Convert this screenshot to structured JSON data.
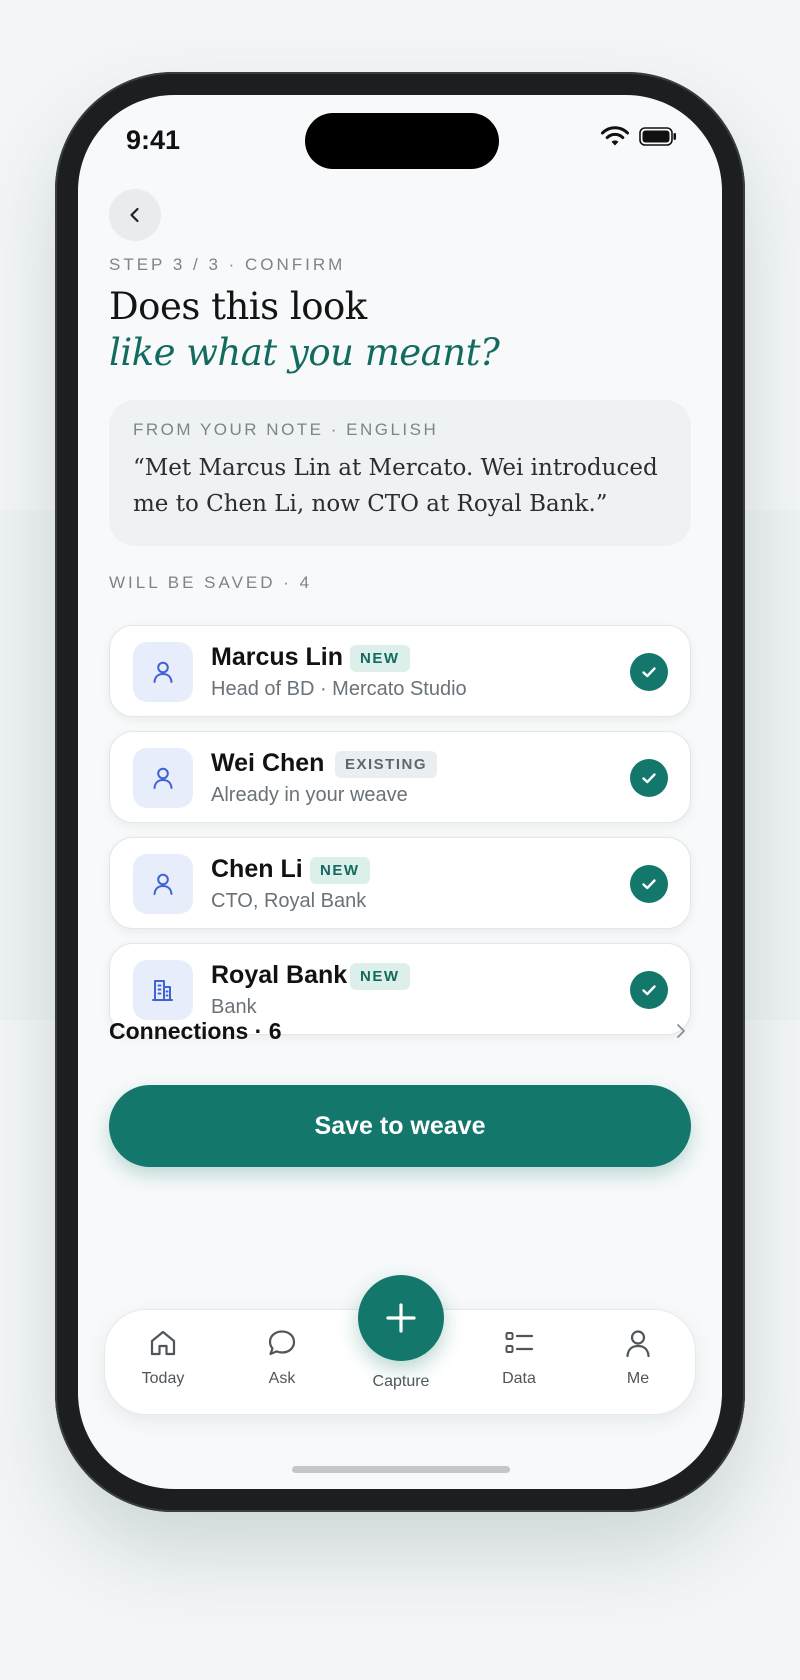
{
  "status_bar": {
    "time": "9:41"
  },
  "header": {
    "step": "STEP 3 / 3 · CONFIRM",
    "title_line1": "Does this look",
    "title_line2": "like what you meant?"
  },
  "note": {
    "label": "FROM YOUR NOTE · ENGLISH",
    "quote": "“Met Marcus Lin at Mercato. Wei introduced me to Chen Li, now CTO at Royal Bank.”"
  },
  "saved": {
    "label": "WILL BE SAVED · 4",
    "items": [
      {
        "name": "Marcus Lin",
        "badge": "NEW",
        "subtitle": "Head of BD · Mercato Studio",
        "icon": "person-icon",
        "checked": true
      },
      {
        "name": "Wei Chen",
        "badge": "EXISTING",
        "subtitle": "Already in your weave",
        "icon": "person-icon",
        "checked": true
      },
      {
        "name": "Chen Li",
        "badge": "NEW",
        "subtitle": "CTO, Royal Bank",
        "icon": "person-icon",
        "checked": true
      },
      {
        "name": "Royal Bank",
        "badge": "NEW",
        "subtitle": "Bank",
        "icon": "building-icon",
        "checked": true
      }
    ]
  },
  "connections": {
    "label": "Connections · 6"
  },
  "actions": {
    "save_label": "Save to weave"
  },
  "tab_bar": {
    "tabs": [
      {
        "label": "Today",
        "icon": "home-icon"
      },
      {
        "label": "Ask",
        "icon": "chat-bubble-icon"
      },
      {
        "label": "Capture",
        "icon": "plus-icon"
      },
      {
        "label": "Data",
        "icon": "list-icon"
      },
      {
        "label": "Me",
        "icon": "profile-icon"
      }
    ]
  },
  "colors": {
    "accent": "#13776b",
    "accent_text": "#136b5f",
    "icon_blue": "#3f63d4",
    "icon_bg": "#e8edfb"
  }
}
